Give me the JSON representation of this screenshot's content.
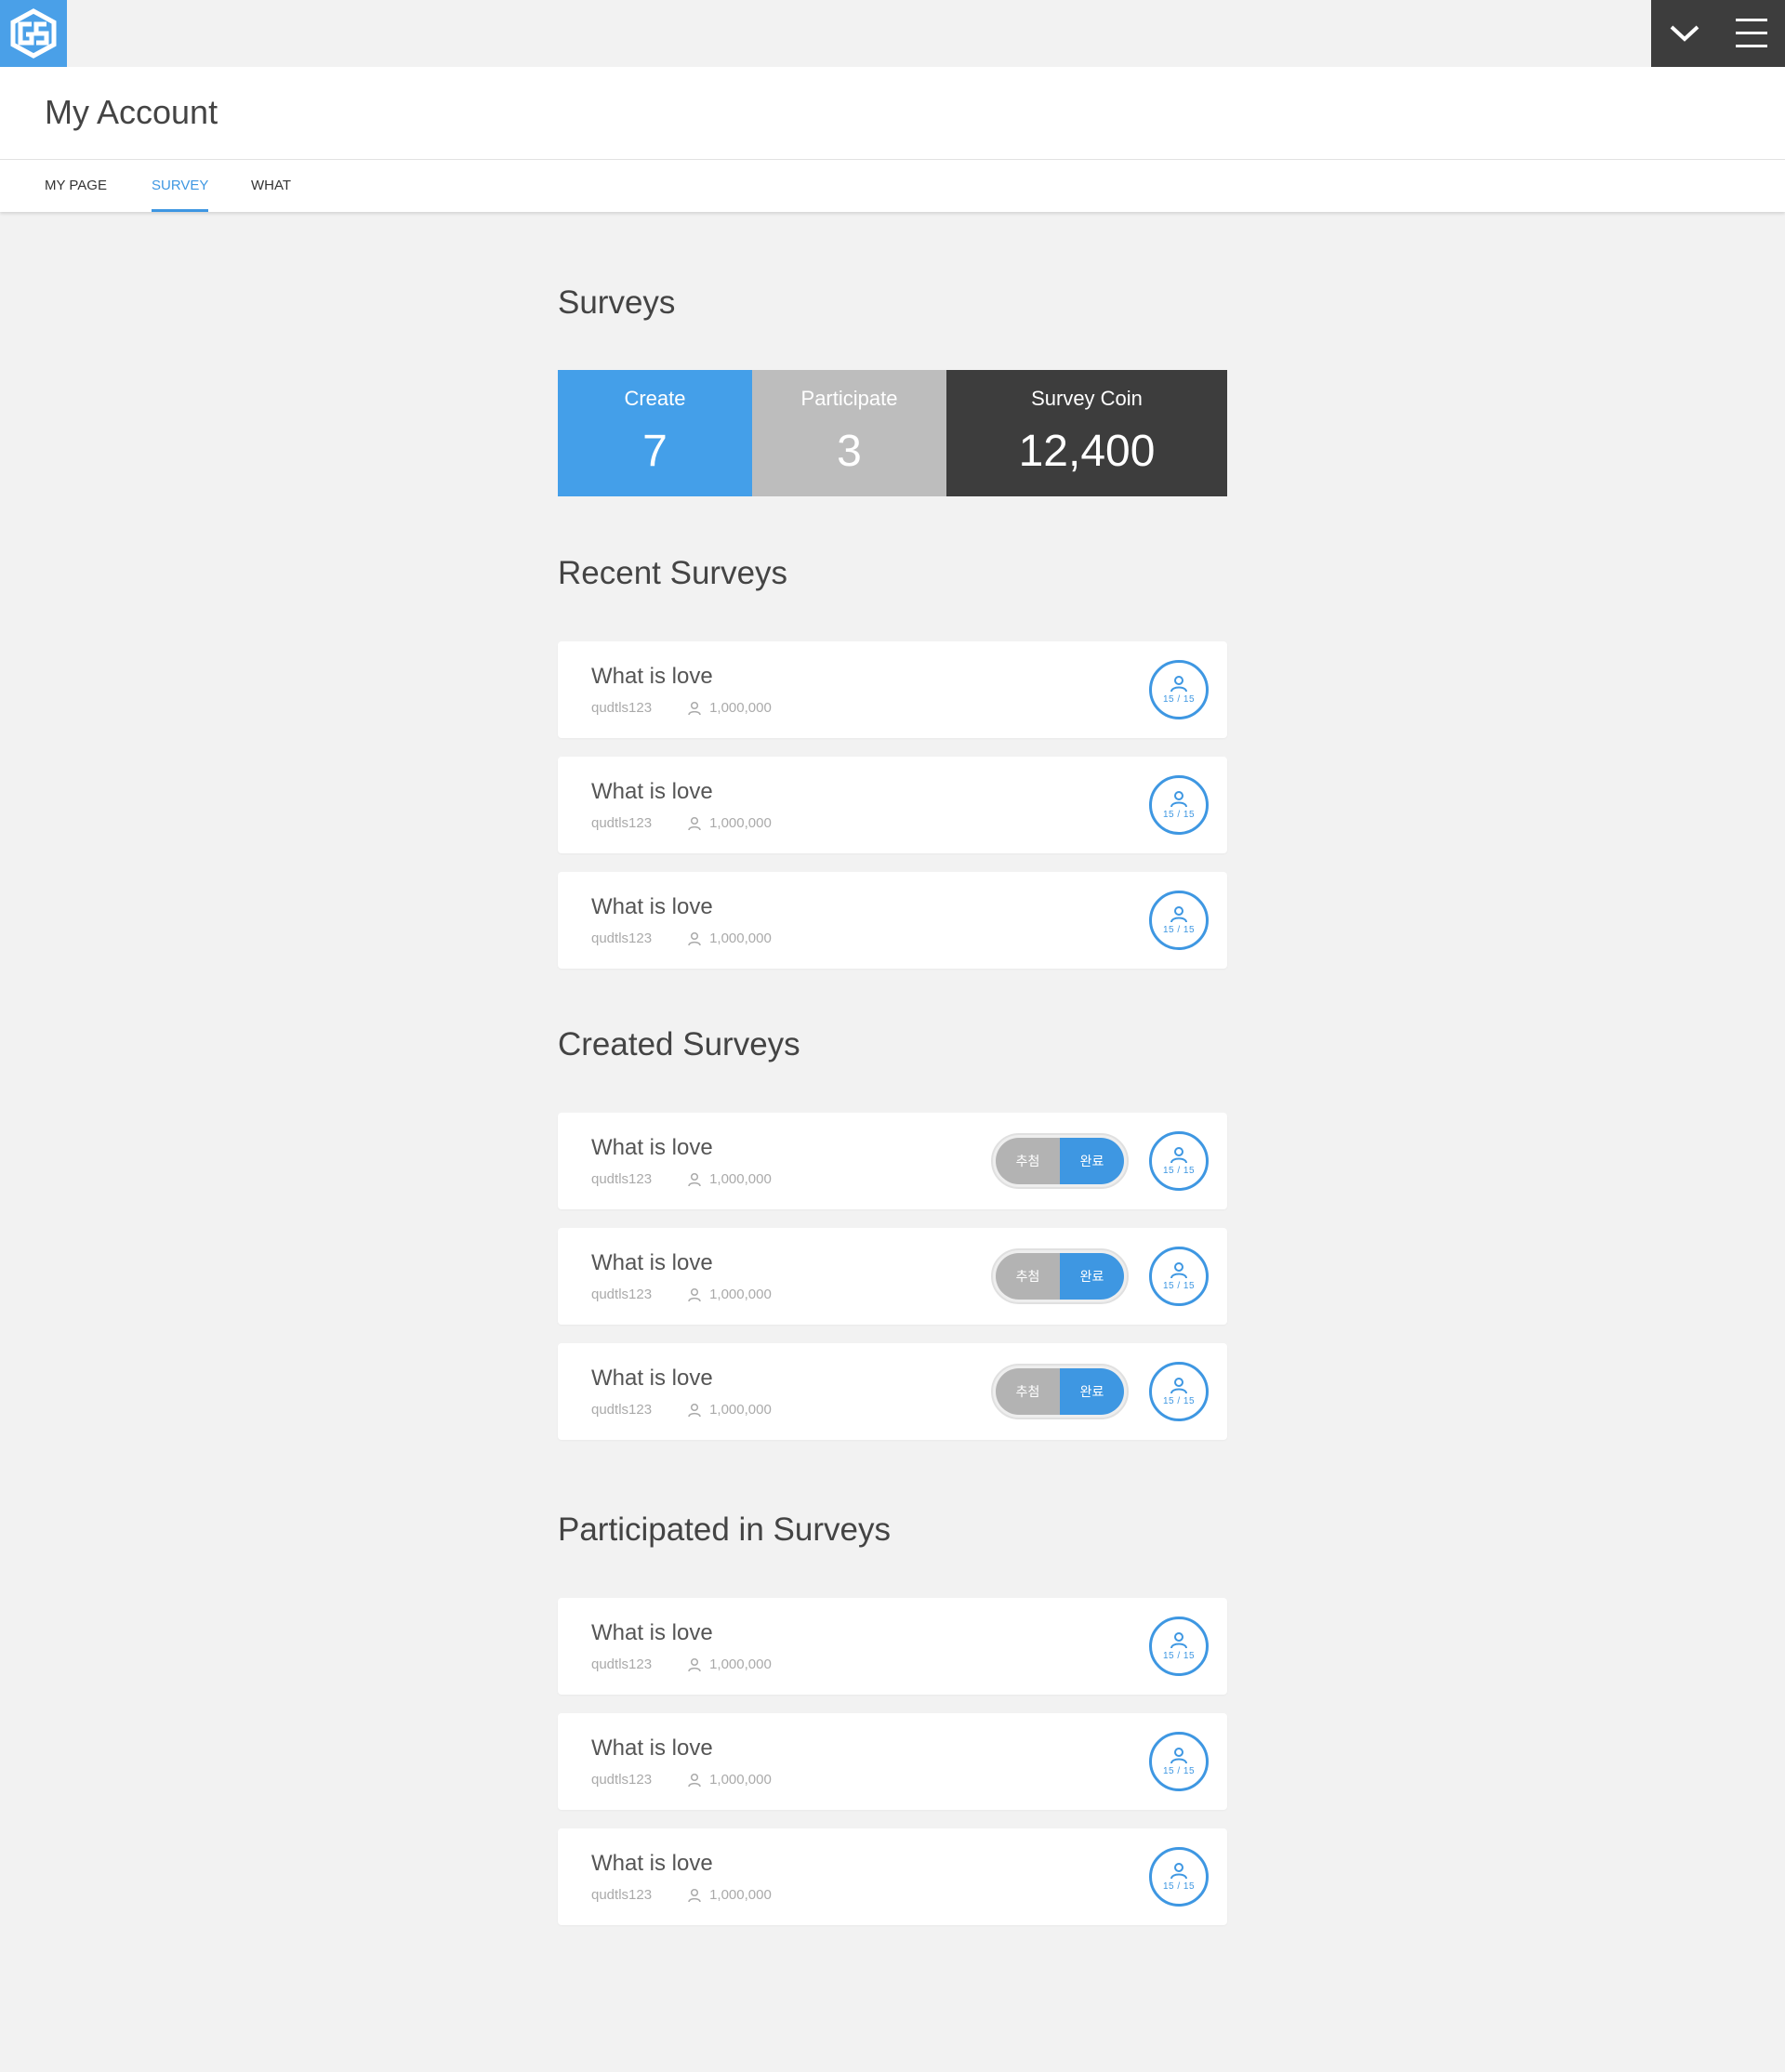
{
  "app": {
    "logo_icon": "gs-logo-icon",
    "actions": [
      {
        "icon": "chevron-down-icon"
      },
      {
        "icon": "hamburger-menu-icon"
      }
    ]
  },
  "header": {
    "title": "My Account"
  },
  "tabs": [
    {
      "label": "MY PAGE",
      "active": false
    },
    {
      "label": "SURVEY",
      "active": true
    },
    {
      "label": "WHAT",
      "active": false
    }
  ],
  "colors": {
    "accent": "#3e97e2",
    "create_bg": "#449fe9",
    "participate_bg": "#bdbdbd",
    "coin_bg": "#3d3d3d",
    "page_bg": "#f2f2f2"
  },
  "surveys": {
    "title": "Surveys",
    "stats": [
      {
        "label": "Create",
        "value": "7"
      },
      {
        "label": "Participate",
        "value": "3"
      },
      {
        "label": "Survey Coin",
        "value": "12,400"
      }
    ]
  },
  "recent": {
    "title": "Recent Surveys",
    "items": [
      {
        "title": "What is love",
        "user": "qudtls123",
        "count": "1,000,000",
        "ratio": "15 / 15"
      },
      {
        "title": "What is love",
        "user": "qudtls123",
        "count": "1,000,000",
        "ratio": "15 / 15"
      },
      {
        "title": "What is love",
        "user": "qudtls123",
        "count": "1,000,000",
        "ratio": "15 / 15"
      }
    ]
  },
  "created": {
    "title": "Created Surveys",
    "toggle_left": "추첨",
    "toggle_right": "완료",
    "items": [
      {
        "title": "What is love",
        "user": "qudtls123",
        "count": "1,000,000",
        "ratio": "15 / 15"
      },
      {
        "title": "What is love",
        "user": "qudtls123",
        "count": "1,000,000",
        "ratio": "15 / 15"
      },
      {
        "title": "What is love",
        "user": "qudtls123",
        "count": "1,000,000",
        "ratio": "15 / 15"
      }
    ]
  },
  "participated": {
    "title": "Participated in Surveys",
    "items": [
      {
        "title": "What is love",
        "user": "qudtls123",
        "count": "1,000,000",
        "ratio": "15 / 15"
      },
      {
        "title": "What is love",
        "user": "qudtls123",
        "count": "1,000,000",
        "ratio": "15 / 15"
      },
      {
        "title": "What is love",
        "user": "qudtls123",
        "count": "1,000,000",
        "ratio": "15 / 15"
      }
    ]
  }
}
